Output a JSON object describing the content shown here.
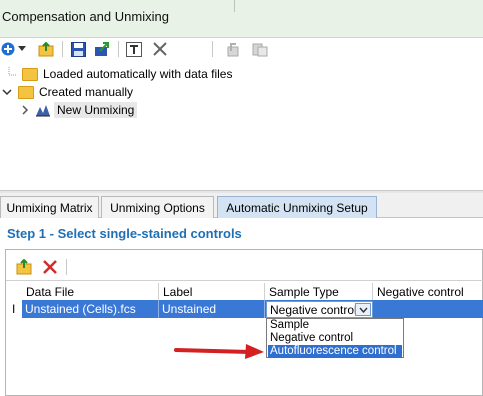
{
  "window": {
    "title": "Compensation and Unmixing"
  },
  "toolbar": {
    "icons": [
      "add-icon",
      "chevron-down-icon",
      "folder-up-icon",
      "save-icon",
      "export-icon",
      "text-icon",
      "delete-icon",
      "copy-disabled-icon",
      "paste-disabled-icon"
    ]
  },
  "tree": {
    "items": [
      {
        "label": "Loaded automatically with data files"
      },
      {
        "label": "Created manually"
      },
      {
        "label": "New Unmixing"
      }
    ]
  },
  "tabs": [
    {
      "label": "Unmixing Matrix"
    },
    {
      "label": "Unmixing Options"
    },
    {
      "label": "Automatic Unmixing Setup"
    }
  ],
  "step": {
    "title": "Step 1 - Select single-stained controls"
  },
  "table": {
    "columns": [
      "Data File",
      "Label",
      "Sample Type",
      "Negative control"
    ],
    "rows": [
      {
        "marker": "I",
        "data_file": "Unstained (Cells).fcs",
        "label": "Unstained",
        "sample_type": "Negative control",
        "negative_control": ""
      }
    ]
  },
  "dropdown": {
    "options": [
      "Sample",
      "Negative control",
      "Autofluorescence control"
    ],
    "highlighted": "Autofluorescence control"
  },
  "colors": {
    "accent": "#1e6fb5",
    "selection": "#3a78d6",
    "arrow": "#d42020"
  }
}
